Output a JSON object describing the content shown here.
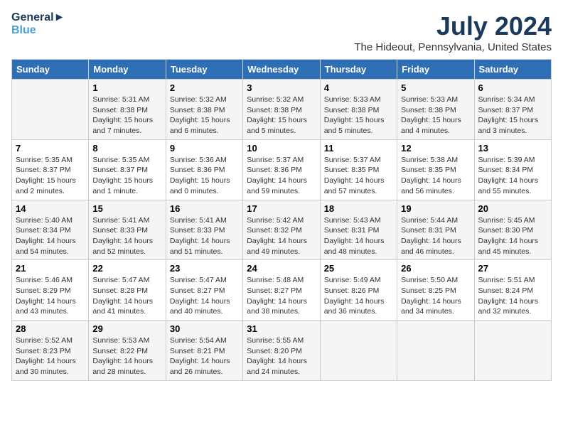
{
  "header": {
    "logo_line1": "General",
    "logo_line2": "Blue",
    "month_year": "July 2024",
    "location": "The Hideout, Pennsylvania, United States"
  },
  "weekdays": [
    "Sunday",
    "Monday",
    "Tuesday",
    "Wednesday",
    "Thursday",
    "Friday",
    "Saturday"
  ],
  "weeks": [
    [
      {
        "day": "",
        "sunrise": "",
        "sunset": "",
        "daylight": ""
      },
      {
        "day": "1",
        "sunrise": "Sunrise: 5:31 AM",
        "sunset": "Sunset: 8:38 PM",
        "daylight": "Daylight: 15 hours and 7 minutes."
      },
      {
        "day": "2",
        "sunrise": "Sunrise: 5:32 AM",
        "sunset": "Sunset: 8:38 PM",
        "daylight": "Daylight: 15 hours and 6 minutes."
      },
      {
        "day": "3",
        "sunrise": "Sunrise: 5:32 AM",
        "sunset": "Sunset: 8:38 PM",
        "daylight": "Daylight: 15 hours and 5 minutes."
      },
      {
        "day": "4",
        "sunrise": "Sunrise: 5:33 AM",
        "sunset": "Sunset: 8:38 PM",
        "daylight": "Daylight: 15 hours and 5 minutes."
      },
      {
        "day": "5",
        "sunrise": "Sunrise: 5:33 AM",
        "sunset": "Sunset: 8:38 PM",
        "daylight": "Daylight: 15 hours and 4 minutes."
      },
      {
        "day": "6",
        "sunrise": "Sunrise: 5:34 AM",
        "sunset": "Sunset: 8:37 PM",
        "daylight": "Daylight: 15 hours and 3 minutes."
      }
    ],
    [
      {
        "day": "7",
        "sunrise": "Sunrise: 5:35 AM",
        "sunset": "Sunset: 8:37 PM",
        "daylight": "Daylight: 15 hours and 2 minutes."
      },
      {
        "day": "8",
        "sunrise": "Sunrise: 5:35 AM",
        "sunset": "Sunset: 8:37 PM",
        "daylight": "Daylight: 15 hours and 1 minute."
      },
      {
        "day": "9",
        "sunrise": "Sunrise: 5:36 AM",
        "sunset": "Sunset: 8:36 PM",
        "daylight": "Daylight: 15 hours and 0 minutes."
      },
      {
        "day": "10",
        "sunrise": "Sunrise: 5:37 AM",
        "sunset": "Sunset: 8:36 PM",
        "daylight": "Daylight: 14 hours and 59 minutes."
      },
      {
        "day": "11",
        "sunrise": "Sunrise: 5:37 AM",
        "sunset": "Sunset: 8:35 PM",
        "daylight": "Daylight: 14 hours and 57 minutes."
      },
      {
        "day": "12",
        "sunrise": "Sunrise: 5:38 AM",
        "sunset": "Sunset: 8:35 PM",
        "daylight": "Daylight: 14 hours and 56 minutes."
      },
      {
        "day": "13",
        "sunrise": "Sunrise: 5:39 AM",
        "sunset": "Sunset: 8:34 PM",
        "daylight": "Daylight: 14 hours and 55 minutes."
      }
    ],
    [
      {
        "day": "14",
        "sunrise": "Sunrise: 5:40 AM",
        "sunset": "Sunset: 8:34 PM",
        "daylight": "Daylight: 14 hours and 54 minutes."
      },
      {
        "day": "15",
        "sunrise": "Sunrise: 5:41 AM",
        "sunset": "Sunset: 8:33 PM",
        "daylight": "Daylight: 14 hours and 52 minutes."
      },
      {
        "day": "16",
        "sunrise": "Sunrise: 5:41 AM",
        "sunset": "Sunset: 8:33 PM",
        "daylight": "Daylight: 14 hours and 51 minutes."
      },
      {
        "day": "17",
        "sunrise": "Sunrise: 5:42 AM",
        "sunset": "Sunset: 8:32 PM",
        "daylight": "Daylight: 14 hours and 49 minutes."
      },
      {
        "day": "18",
        "sunrise": "Sunrise: 5:43 AM",
        "sunset": "Sunset: 8:31 PM",
        "daylight": "Daylight: 14 hours and 48 minutes."
      },
      {
        "day": "19",
        "sunrise": "Sunrise: 5:44 AM",
        "sunset": "Sunset: 8:31 PM",
        "daylight": "Daylight: 14 hours and 46 minutes."
      },
      {
        "day": "20",
        "sunrise": "Sunrise: 5:45 AM",
        "sunset": "Sunset: 8:30 PM",
        "daylight": "Daylight: 14 hours and 45 minutes."
      }
    ],
    [
      {
        "day": "21",
        "sunrise": "Sunrise: 5:46 AM",
        "sunset": "Sunset: 8:29 PM",
        "daylight": "Daylight: 14 hours and 43 minutes."
      },
      {
        "day": "22",
        "sunrise": "Sunrise: 5:47 AM",
        "sunset": "Sunset: 8:28 PM",
        "daylight": "Daylight: 14 hours and 41 minutes."
      },
      {
        "day": "23",
        "sunrise": "Sunrise: 5:47 AM",
        "sunset": "Sunset: 8:27 PM",
        "daylight": "Daylight: 14 hours and 40 minutes."
      },
      {
        "day": "24",
        "sunrise": "Sunrise: 5:48 AM",
        "sunset": "Sunset: 8:27 PM",
        "daylight": "Daylight: 14 hours and 38 minutes."
      },
      {
        "day": "25",
        "sunrise": "Sunrise: 5:49 AM",
        "sunset": "Sunset: 8:26 PM",
        "daylight": "Daylight: 14 hours and 36 minutes."
      },
      {
        "day": "26",
        "sunrise": "Sunrise: 5:50 AM",
        "sunset": "Sunset: 8:25 PM",
        "daylight": "Daylight: 14 hours and 34 minutes."
      },
      {
        "day": "27",
        "sunrise": "Sunrise: 5:51 AM",
        "sunset": "Sunset: 8:24 PM",
        "daylight": "Daylight: 14 hours and 32 minutes."
      }
    ],
    [
      {
        "day": "28",
        "sunrise": "Sunrise: 5:52 AM",
        "sunset": "Sunset: 8:23 PM",
        "daylight": "Daylight: 14 hours and 30 minutes."
      },
      {
        "day": "29",
        "sunrise": "Sunrise: 5:53 AM",
        "sunset": "Sunset: 8:22 PM",
        "daylight": "Daylight: 14 hours and 28 minutes."
      },
      {
        "day": "30",
        "sunrise": "Sunrise: 5:54 AM",
        "sunset": "Sunset: 8:21 PM",
        "daylight": "Daylight: 14 hours and 26 minutes."
      },
      {
        "day": "31",
        "sunrise": "Sunrise: 5:55 AM",
        "sunset": "Sunset: 8:20 PM",
        "daylight": "Daylight: 14 hours and 24 minutes."
      },
      {
        "day": "",
        "sunrise": "",
        "sunset": "",
        "daylight": ""
      },
      {
        "day": "",
        "sunrise": "",
        "sunset": "",
        "daylight": ""
      },
      {
        "day": "",
        "sunrise": "",
        "sunset": "",
        "daylight": ""
      }
    ]
  ]
}
